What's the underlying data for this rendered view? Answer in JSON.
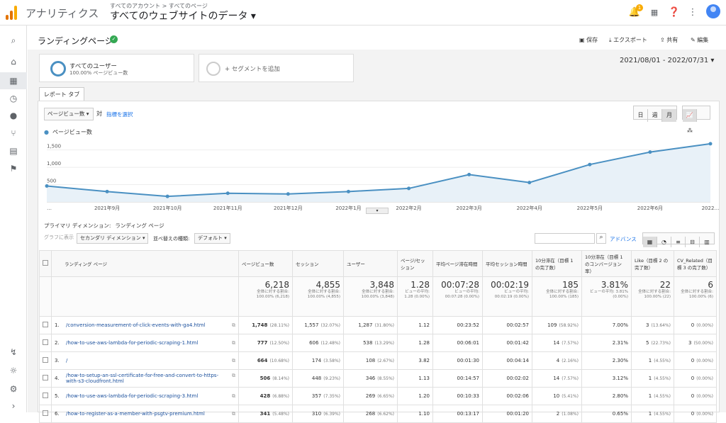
{
  "app": {
    "name": "アナリティクス",
    "breadcrumb": "すべてのアカウント > すべてのページ",
    "account": "すべてのウェブサイトのデータ ▾",
    "notif_count": "1"
  },
  "page": {
    "title": "ランディングページ",
    "actions": [
      "保存",
      "エクスポート",
      "共有",
      "編集"
    ]
  },
  "segments": {
    "active_title": "すべてのユーザー",
    "active_sub": "100.00% ページビュー数",
    "add": "+ セグメントを追加"
  },
  "date_range": "2021/08/01 - 2022/07/31 ▾",
  "report_tab": "レポート タブ",
  "metric": {
    "selected": "ページビュー数 ▾",
    "vs": "対",
    "select": "指標を選択"
  },
  "granularity": [
    "日",
    "週",
    "月"
  ],
  "colors": {
    "line": "#4a90c2",
    "fill": "#e8f1f8",
    "accent": "#4285f4"
  },
  "chart_data": {
    "type": "area",
    "legend": "ページビュー数",
    "series": [
      {
        "name": "ページビュー数",
        "values": [
          460,
          300,
          160,
          250,
          230,
          300,
          390,
          790,
          560,
          1080,
          1440,
          1680
        ]
      }
    ],
    "x": [
      "2021年8月",
      "2021年9月",
      "2021年10月",
      "2021年11月",
      "2021年12月",
      "2022年1月",
      "2022年2月",
      "2022年3月",
      "2022年4月",
      "2022年5月",
      "2022年6月",
      "2022年7月"
    ],
    "xticklabels": [
      "…",
      "2021年9月",
      "2021年10月",
      "2021年11月",
      "2021年12月",
      "2022年1月",
      "2022年2月",
      "2022年3月",
      "2022年4月",
      "2022年5月",
      "2022年6月",
      "2022…"
    ],
    "yticks": [
      "500",
      "1,000",
      "1,500"
    ],
    "ylim": [
      0,
      1800
    ]
  },
  "dimension": {
    "label": "プライマリ ディメンション:",
    "value": "ランディング ページ"
  },
  "controls": {
    "plot": "グラフに表示",
    "secondary": "セカンダリ ディメンション ▾",
    "sort_label": "並べ替えの種類:",
    "sort": "デフォルト ▾",
    "advanced": "アドバンス"
  },
  "columns": [
    "ランディング ページ",
    "ページビュー数",
    "セッション",
    "ユーザー",
    "ページ/セッション",
    "平均ページ滞在時間",
    "平均セッション時間",
    "10分滞在（目標 1 の完了数）",
    "10分滞在（目標 1 のコンバージョン率）",
    "Like（目標 2 の完了数）",
    "CV_Related（目標 3 の完了数）"
  ],
  "totals": [
    {
      "v": "6,218",
      "s": "全体に対する割合: 100.00% (6,218)"
    },
    {
      "v": "4,855",
      "s": "全体に対する割合: 100.00% (4,855)"
    },
    {
      "v": "3,848",
      "s": "全体に対する割合: 100.00% (3,848)"
    },
    {
      "v": "1.28",
      "s": "ビューの平均: 1.28 (0.00%)"
    },
    {
      "v": "00:07:28",
      "s": "ビューの平均: 00:07:28 (0.00%)"
    },
    {
      "v": "00:02:19",
      "s": "ビューの平均: 00:02:19 (0.00%)"
    },
    {
      "v": "185",
      "s": "全体に対する割合: 100.00% (185)"
    },
    {
      "v": "3.81%",
      "s": "ビューの平均: 3.81% (0.00%)"
    },
    {
      "v": "22",
      "s": "全体に対する割合: 100.00% (22)"
    },
    {
      "v": "6",
      "s": "全体に対する割合: 100.00% (6)"
    }
  ],
  "rows": [
    {
      "n": "1.",
      "url": "/conversion-measurement-of-click-events-with-ga4.html",
      "pv": "1,748",
      "pvp": "(28.11%)",
      "ses": "1,557",
      "sesp": "(32.07%)",
      "usr": "1,287",
      "usrp": "(31.80%)",
      "pps": "1.12",
      "apt": "00:23:52",
      "ast": "00:02:57",
      "g1": "109",
      "g1p": "(58.92%)",
      "cr": "7.00%",
      "g2": "3",
      "g2p": "(13.64%)",
      "g3": "0",
      "g3p": "(0.00%)"
    },
    {
      "n": "2.",
      "url": "/how-to-use-aws-lambda-for-periodic-scraping-1.html",
      "pv": "777",
      "pvp": "(12.50%)",
      "ses": "606",
      "sesp": "(12.48%)",
      "usr": "538",
      "usrp": "(13.29%)",
      "pps": "1.28",
      "apt": "00:06:01",
      "ast": "00:01:42",
      "g1": "14",
      "g1p": "(7.57%)",
      "cr": "2.31%",
      "g2": "5",
      "g2p": "(22.73%)",
      "g3": "3",
      "g3p": "(50.00%)"
    },
    {
      "n": "3.",
      "url": "/",
      "pv": "664",
      "pvp": "(10.68%)",
      "ses": "174",
      "sesp": "(3.58%)",
      "usr": "108",
      "usrp": "(2.67%)",
      "pps": "3.82",
      "apt": "00:01:30",
      "ast": "00:04:14",
      "g1": "4",
      "g1p": "(2.16%)",
      "cr": "2.30%",
      "g2": "1",
      "g2p": "(4.55%)",
      "g3": "0",
      "g3p": "(0.00%)"
    },
    {
      "n": "4.",
      "url": "/how-to-setup-an-ssl-certificate-for-free-and-convert-to-https-with-s3-cloudfront.html",
      "pv": "506",
      "pvp": "(8.14%)",
      "ses": "448",
      "sesp": "(9.23%)",
      "usr": "346",
      "usrp": "(8.55%)",
      "pps": "1.13",
      "apt": "00:14:57",
      "ast": "00:02:02",
      "g1": "14",
      "g1p": "(7.57%)",
      "cr": "3.12%",
      "g2": "1",
      "g2p": "(4.55%)",
      "g3": "0",
      "g3p": "(0.00%)"
    },
    {
      "n": "5.",
      "url": "/how-to-use-aws-lambda-for-periodic-scraping-3.html",
      "pv": "428",
      "pvp": "(6.88%)",
      "ses": "357",
      "sesp": "(7.35%)",
      "usr": "269",
      "usrp": "(6.65%)",
      "pps": "1.20",
      "apt": "00:10:33",
      "ast": "00:02:06",
      "g1": "10",
      "g1p": "(5.41%)",
      "cr": "2.80%",
      "g2": "1",
      "g2p": "(4.55%)",
      "g3": "0",
      "g3p": "(0.00%)"
    },
    {
      "n": "6.",
      "url": "/how-to-register-as-a-member-with-psgtv-premium.html",
      "pv": "341",
      "pvp": "(5.48%)",
      "ses": "310",
      "sesp": "(6.39%)",
      "usr": "268",
      "usrp": "(6.62%)",
      "pps": "1.10",
      "apt": "00:13:17",
      "ast": "00:01:20",
      "g1": "2",
      "g1p": "(1.08%)",
      "cr": "0.65%",
      "g2": "1",
      "g2p": "(4.55%)",
      "g3": "0",
      "g3p": "(0.00%)"
    }
  ]
}
